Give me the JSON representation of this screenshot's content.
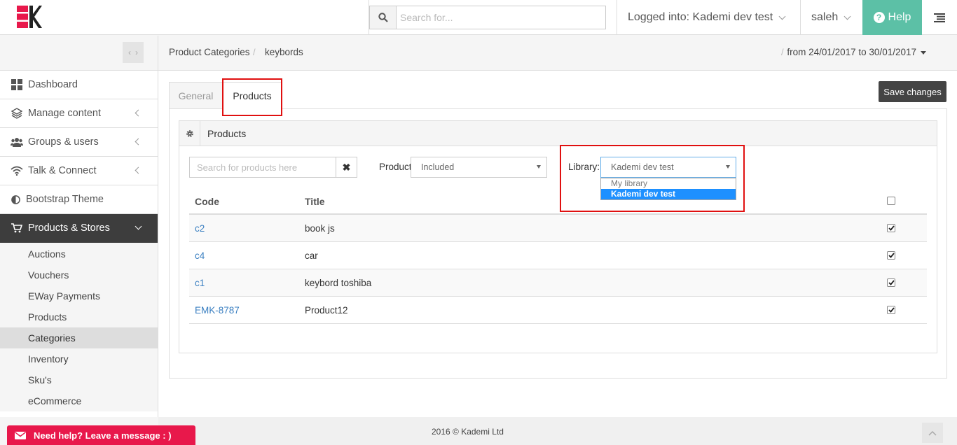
{
  "header": {
    "search_placeholder": "Search for...",
    "logged_into": "Logged into: Kademi dev test",
    "user": "saleh",
    "help_label": "Help"
  },
  "sidebar": {
    "items": [
      {
        "label": "Dashboard",
        "icon": "dashboard-icon"
      },
      {
        "label": "Manage content",
        "icon": "layers-icon"
      },
      {
        "label": "Groups & users",
        "icon": "users-icon"
      },
      {
        "label": "Talk & Connect",
        "icon": "wifi-icon"
      },
      {
        "label": "Bootstrap Theme",
        "icon": "contrast-icon"
      },
      {
        "label": "Products & Stores",
        "icon": "cart-icon"
      }
    ],
    "sub_items": [
      "Auctions",
      "Vouchers",
      "EWay Payments",
      "Products",
      "Categories",
      "Inventory",
      "Sku's",
      "eCommerce"
    ],
    "active_sub": "Categories"
  },
  "breadcrumb": {
    "items": [
      "Product Categories",
      "keybords"
    ],
    "separator": "/",
    "date_range": "from 24/01/2017 to 30/01/2017"
  },
  "tabs": {
    "general": "General",
    "products": "Products",
    "active": "Products"
  },
  "toolbar": {
    "save_label": "Save changes"
  },
  "panel": {
    "title": "Products",
    "search_placeholder": "Search for products here",
    "product_label": "Product",
    "product_filter": "Included",
    "library_label": "Library:",
    "library_selected": "Kademi dev test",
    "library_options": [
      "My library",
      "Kademi dev test"
    ]
  },
  "table": {
    "columns": [
      "Code",
      "Title"
    ],
    "rows": [
      {
        "code": "c2",
        "title": "book js",
        "checked": true
      },
      {
        "code": "c4",
        "title": "car",
        "checked": true
      },
      {
        "code": "c1",
        "title": "keybord toshiba",
        "checked": true
      },
      {
        "code": "EMK-8787",
        "title": "Product12",
        "checked": true
      }
    ]
  },
  "footer": {
    "copyright": "2016 © Kademi Ltd",
    "need_help": "Need help? Leave a message : )"
  },
  "colors": {
    "accent_help": "#5cc0a6",
    "need_help": "#e8184b",
    "logo": "#e8184b",
    "highlight": "#e01010",
    "link": "#3a7fc1"
  }
}
